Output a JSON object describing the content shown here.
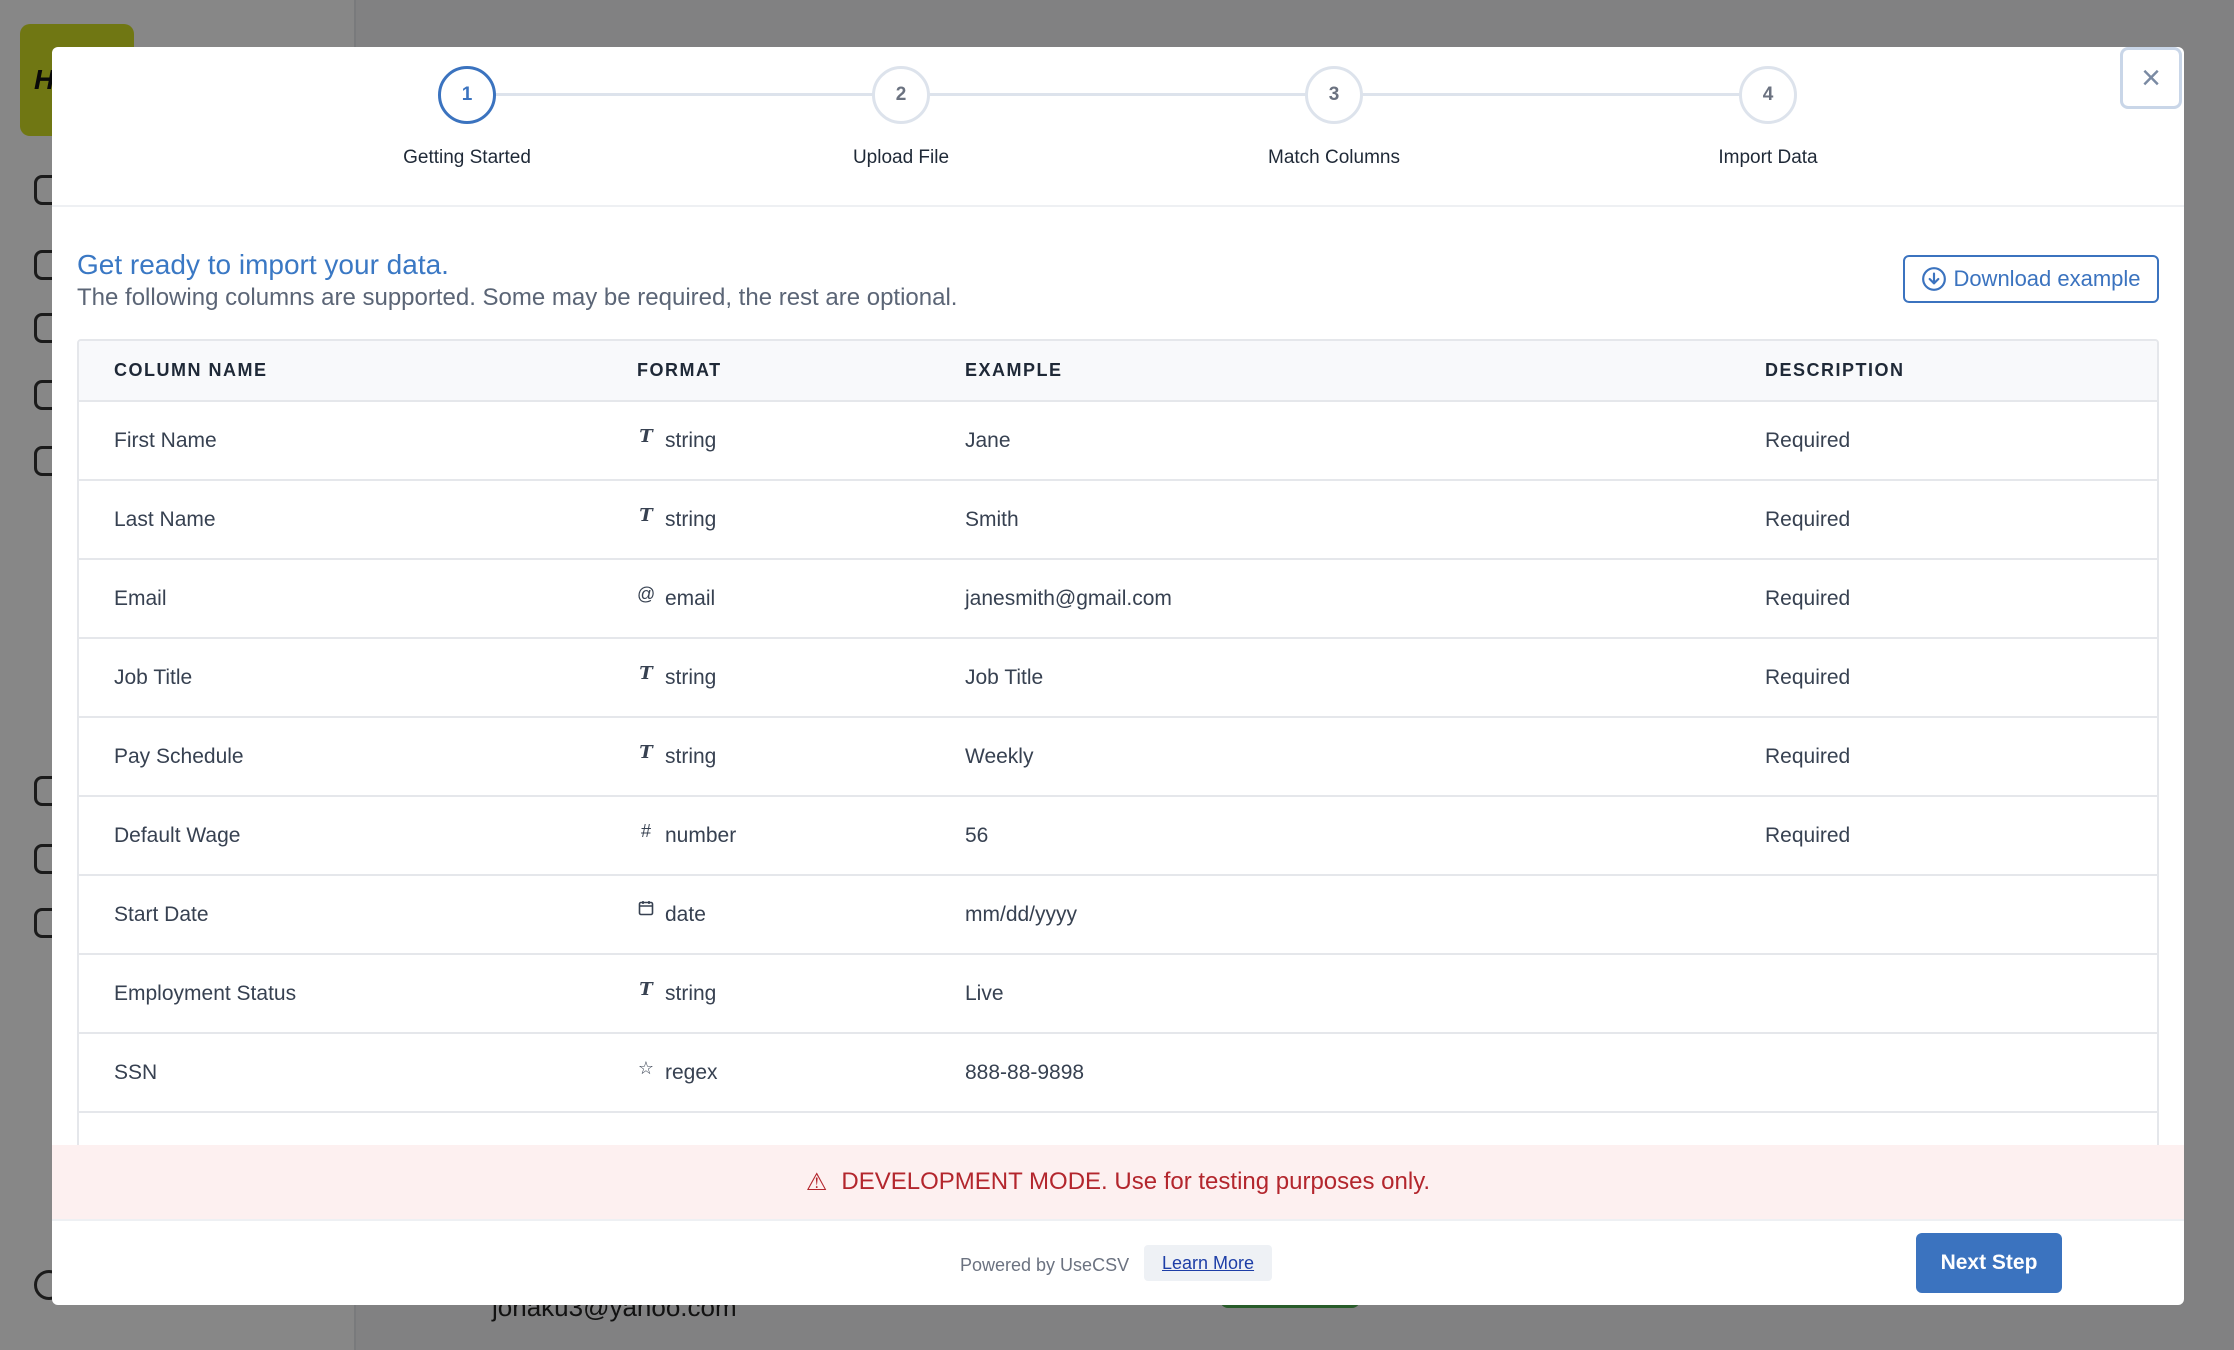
{
  "background": {
    "logo_text": "H",
    "email": "jonaku3@yahoo.com"
  },
  "modal": {
    "close_label": "×",
    "steps": [
      {
        "number": "1",
        "label": "Getting Started"
      },
      {
        "number": "2",
        "label": "Upload File"
      },
      {
        "number": "3",
        "label": "Match Columns"
      },
      {
        "number": "4",
        "label": "Import Data"
      }
    ],
    "active_step": 1,
    "intro": {
      "title": "Get ready to import your data.",
      "subtitle": "The following columns are supported. Some may be required, the rest are optional."
    },
    "download_label": "Download example",
    "table": {
      "headers": [
        "COLUMN NAME",
        "FORMAT",
        "EXAMPLE",
        "DESCRIPTION"
      ],
      "rows": [
        {
          "name": "First Name",
          "format_icon": "text-type-icon",
          "format": "string",
          "example": "Jane",
          "description": "Required"
        },
        {
          "name": "Last Name",
          "format_icon": "text-type-icon",
          "format": "string",
          "example": "Smith",
          "description": "Required"
        },
        {
          "name": "Email",
          "format_icon": "at-sign-icon",
          "format": "email",
          "example": "janesmith@gmail.com",
          "description": "Required"
        },
        {
          "name": "Job Title",
          "format_icon": "text-type-icon",
          "format": "string",
          "example": "Job Title",
          "description": "Required"
        },
        {
          "name": "Pay Schedule",
          "format_icon": "text-type-icon",
          "format": "string",
          "example": "Weekly",
          "description": "Required"
        },
        {
          "name": "Default Wage",
          "format_icon": "hash-icon",
          "format": "number",
          "example": "56",
          "description": "Required"
        },
        {
          "name": "Start Date",
          "format_icon": "calendar-icon",
          "format": "date",
          "example": "mm/dd/yyyy",
          "description": ""
        },
        {
          "name": "Employment Status",
          "format_icon": "text-type-icon",
          "format": "string",
          "example": "Live",
          "description": ""
        },
        {
          "name": "SSN",
          "format_icon": "star-icon",
          "format": "regex",
          "example": "888-88-9898",
          "description": ""
        }
      ]
    },
    "dev_banner": "DEVELOPMENT MODE. Use for testing purposes only.",
    "footer": {
      "powered_by": "Powered by UseCSV",
      "learn_more": "Learn More",
      "next_label": "Next Step"
    },
    "colors": {
      "accent": "#3b73bf",
      "banner_text": "#b3262d",
      "banner_bg": "#fdf0f0"
    }
  }
}
